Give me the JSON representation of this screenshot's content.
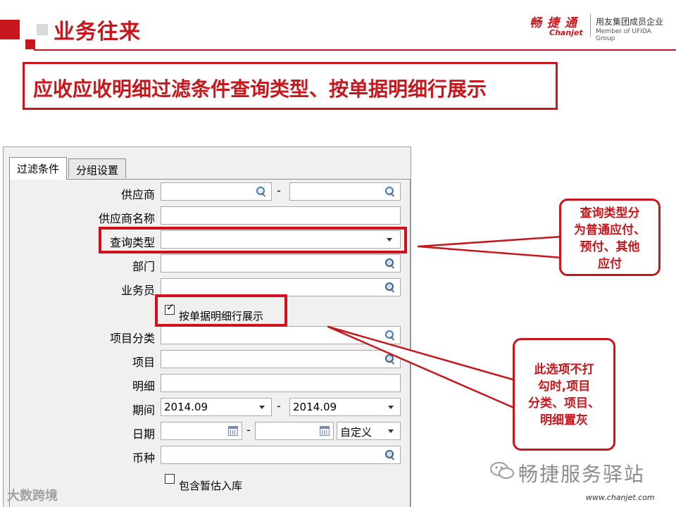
{
  "header": {
    "title": "业务往来",
    "subtitle": "应收应收明细过滤条件查询类型、按单据明细行展示",
    "logo_cn": "畅 捷 通",
    "logo_en": "Chanjet",
    "logo_tagline_cn": "用友集团成员企业",
    "logo_tagline_en": "Member of UFIDA Group",
    "brand_color": "#c8161d"
  },
  "dialog": {
    "tabs": [
      {
        "label": "过滤条件",
        "active": true
      },
      {
        "label": "分组设置",
        "active": false
      }
    ],
    "fields": {
      "supplier": {
        "label": "供应商",
        "from_value": "",
        "to_value": ""
      },
      "supplier_name": {
        "label": "供应商名称",
        "value": ""
      },
      "query_type": {
        "label": "查询类型",
        "value": ""
      },
      "department": {
        "label": "部门",
        "value": ""
      },
      "salesperson": {
        "label": "业务员",
        "value": ""
      },
      "show_by_doc_line": {
        "label": "按单据明细行展示",
        "checked": true
      },
      "project_category": {
        "label": "项目分类",
        "value": ""
      },
      "project": {
        "label": "项目",
        "value": ""
      },
      "detail": {
        "label": "明细",
        "value": ""
      },
      "period": {
        "label": "期间",
        "from_value": "2014.09",
        "to_value": "2014.09"
      },
      "date": {
        "label": "日期",
        "from_value": "",
        "to_value": "",
        "range_option": "自定义"
      },
      "currency": {
        "label": "币种",
        "value": ""
      },
      "include_estimated_inbound": {
        "label": "包含暂估入库",
        "checked": false
      }
    },
    "range_dash": "-"
  },
  "callouts": {
    "query_type": [
      "查询类型分",
      "为普通应付、",
      "预付、其他",
      "应付"
    ],
    "unchecked_note": [
      "此选项不打",
      "勾时,项目",
      "分类、项目、",
      "明细置灰"
    ]
  },
  "watermarks": {
    "left": "大数跨境",
    "right": "畅捷服务驿站",
    "url": "www.chanjet.com"
  }
}
